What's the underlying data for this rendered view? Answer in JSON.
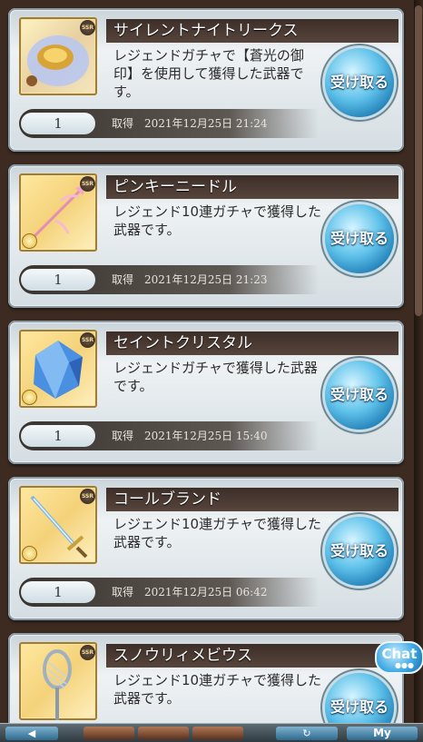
{
  "acquire_label": "取得",
  "claim_label": "受け取る",
  "items": [
    {
      "name": "サイレントナイトリークス",
      "desc": "レジェンドガチャで【蒼光の御印】を使用して獲得した武器です。",
      "qty": "1",
      "date": "2021年12月25日 21:24",
      "rarity": "SSR",
      "icon": "gold-gauntlet-icon"
    },
    {
      "name": "ピンキーニードル",
      "desc": "レジェンド10連ガチャで獲得した武器です。",
      "qty": "1",
      "date": "2021年12月25日 21:23",
      "rarity": "SSR",
      "icon": "pink-spear-icon"
    },
    {
      "name": "セイントクリスタル",
      "desc": "レジェンドガチャで獲得した武器です。",
      "qty": "1",
      "date": "2021年12月25日 15:40",
      "rarity": "SSR",
      "icon": "blue-crystal-icon"
    },
    {
      "name": "コールブランド",
      "desc": "レジェンド10連ガチャで獲得した武器です。",
      "qty": "1",
      "date": "2021年12月25日 06:42",
      "rarity": "SSR",
      "icon": "sword-icon"
    },
    {
      "name": "スノウリィメビウス",
      "desc": "レジェンド10連ガチャで獲得した武器です。",
      "qty": "",
      "date": "",
      "rarity": "SSR",
      "icon": "silver-staff-icon"
    }
  ],
  "chat_label": "Chat",
  "bottom_bar": {
    "back_label": "◀",
    "reload_label": "↻",
    "my_label": "My"
  },
  "colors": {
    "title_bar": "#3c2e28",
    "claim_button": "#3aa6e2",
    "card_background": "#e6ecef"
  }
}
